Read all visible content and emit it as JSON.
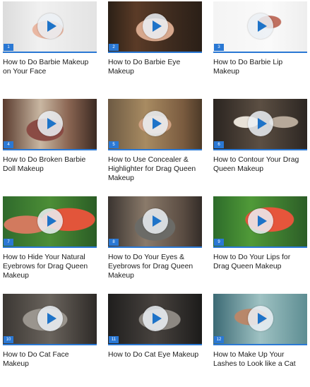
{
  "videos": [
    {
      "number": "1",
      "title": "How to Do Barbie Makeup on Your Face"
    },
    {
      "number": "2",
      "title": "How to Do Barbie Eye Makeup"
    },
    {
      "number": "3",
      "title": "How to Do Barbie Lip Makeup"
    },
    {
      "number": "4",
      "title": "How to Do Broken Barbie Doll Makeup"
    },
    {
      "number": "5",
      "title": "How to Use Concealer & Highlighter for Drag Queen Makeup"
    },
    {
      "number": "6",
      "title": "How to Contour Your Drag Queen Makeup"
    },
    {
      "number": "7",
      "title": "How to Hide Your Natural Eyebrows for Drag Queen Makeup"
    },
    {
      "number": "8",
      "title": "How to Do Your Eyes & Eyebrows for Drag Queen Makeup"
    },
    {
      "number": "9",
      "title": "How to Do Your Lips for Drag Queen Makeup"
    },
    {
      "number": "10",
      "title": "How to Do Cat Face Makeup"
    },
    {
      "number": "11",
      "title": "How to Do Cat Eye Makeup"
    },
    {
      "number": "12",
      "title": "How to Make Up Your Lashes to Look like a Cat"
    }
  ],
  "icons": {
    "play": "play-button-icon"
  },
  "colors": {
    "accent": "#2a78d4",
    "title_text": "#1c1c1c"
  }
}
